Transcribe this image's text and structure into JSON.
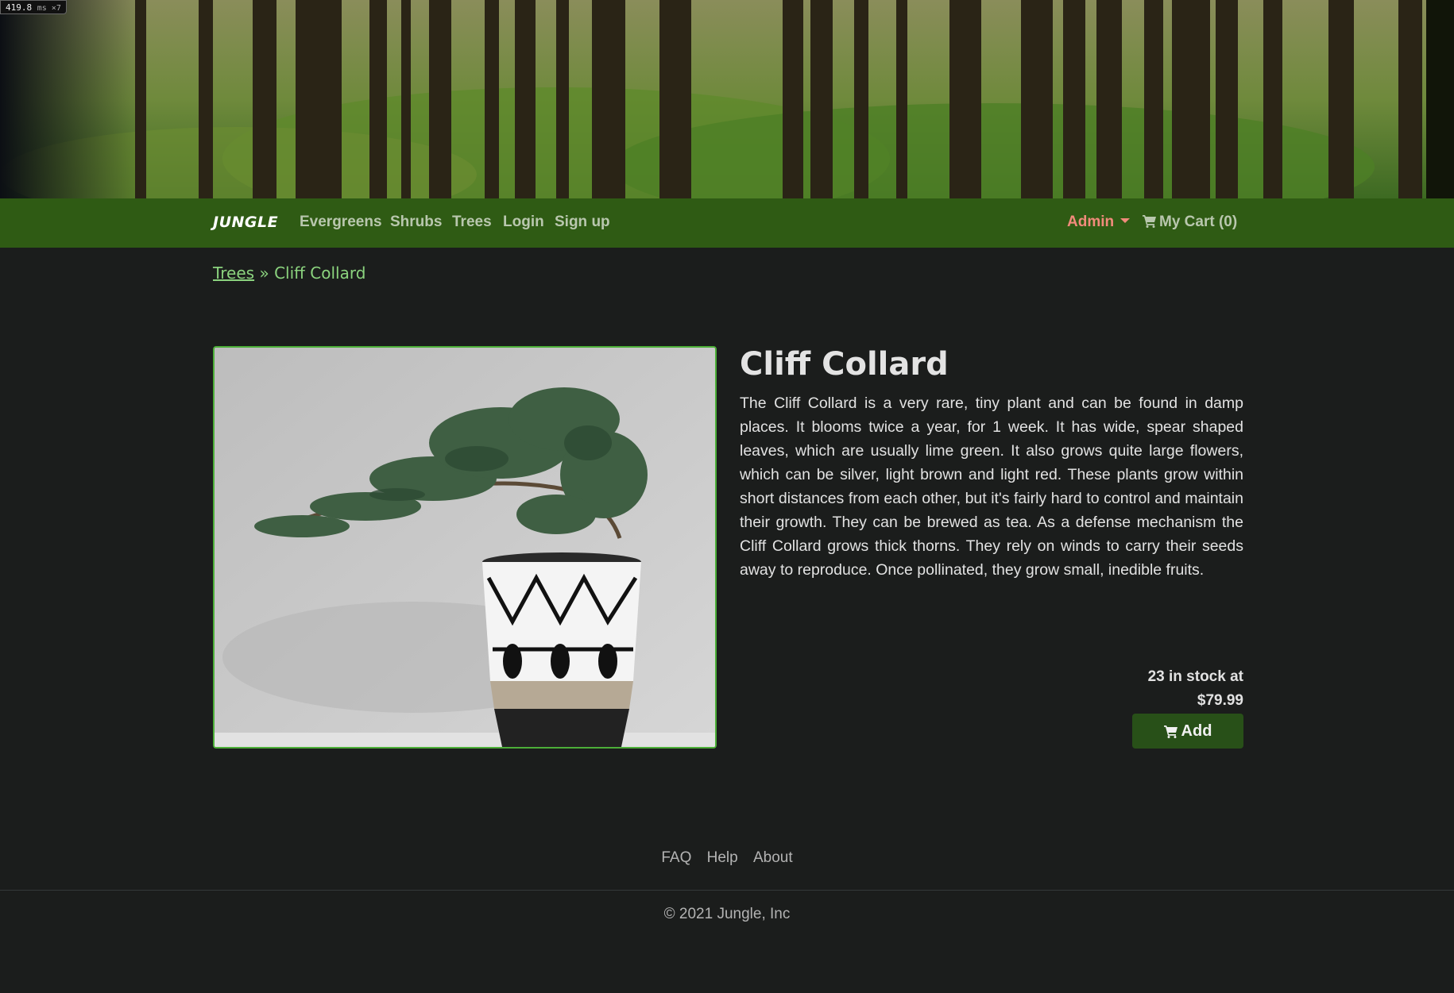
{
  "perf_badge": {
    "value": "419.8",
    "unit": "ms ×7"
  },
  "navbar": {
    "brand": "JUNGLE",
    "links": [
      "Evergreens",
      "Shrubs",
      "Trees",
      "Login",
      "Sign up"
    ],
    "admin": "Admin",
    "cart": "My Cart (0)",
    "bg_color": "#2f5b14"
  },
  "breadcrumb": {
    "parent": "Trees",
    "separator": "»",
    "current": "Cliff Collard"
  },
  "product": {
    "name": "Cliff Collard",
    "description": "The Cliff Collard is a very rare, tiny plant and can be found in damp places. It blooms twice a year, for 1 week. It has wide, spear shaped leaves, which are usually lime green. It also grows quite large flowers, which can be silver, light brown and light red. These plants grow within short distances from each other, but it's fairly hard to control and maintain their growth. They can be brewed as tea. As a defense mechanism the Cliff Collard grows thick thorns. They rely on winds to carry their seeds away to reproduce. Once pollinated, they grow small, inedible fruits.",
    "stock_line": "23 in stock at",
    "price": "$79.99",
    "add_label": "Add"
  },
  "footer": {
    "links": [
      "FAQ",
      "Help",
      "About"
    ],
    "copyright": "© 2021 Jungle, Inc"
  },
  "icons": {
    "cart": "cart-icon",
    "caret": "caret-down-icon"
  },
  "colors": {
    "accent": "#4caf38",
    "page_bg": "#1b1d1c",
    "admin": "#f28b7c",
    "button": "#285018"
  }
}
